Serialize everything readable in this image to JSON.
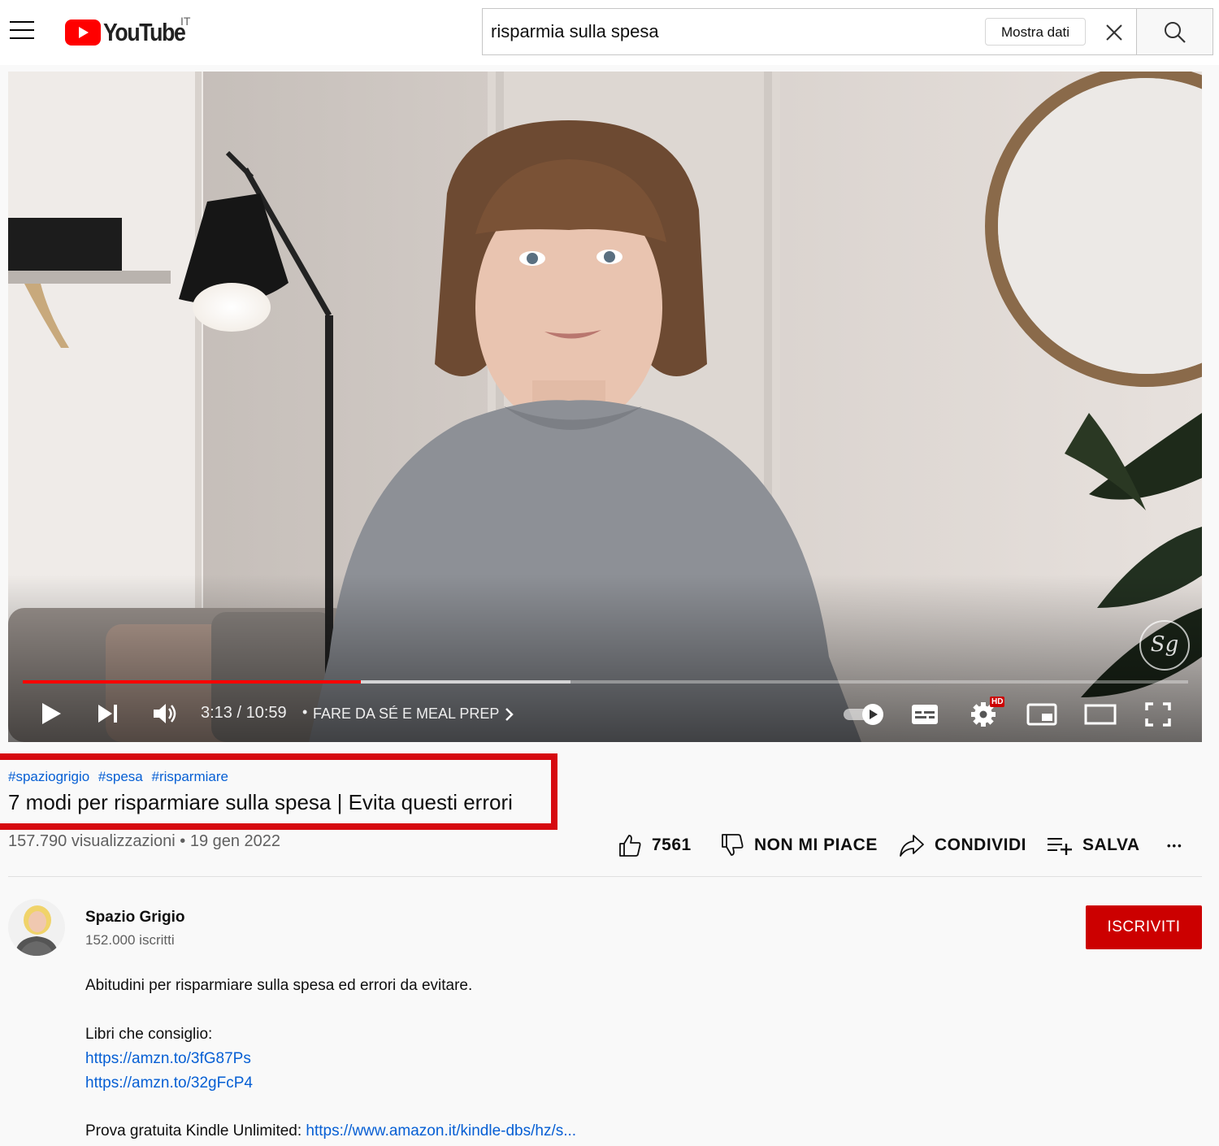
{
  "header": {
    "logo_text": "YouTube",
    "country_code": "IT",
    "search_value": "risparmia sulla spesa",
    "show_data_label": "Mostra dati"
  },
  "player": {
    "current_time": "3:13",
    "time_separator": "/",
    "duration": "10:59",
    "chapter": "FARE DA SÉ E MEAL PREP",
    "watermark": "Sg",
    "hd_badge": "HD",
    "progress_played_fraction": 0.29,
    "progress_buffered_fraction": 0.47
  },
  "video": {
    "hashtags": [
      "#spaziogrigio",
      "#spesa",
      "#risparmiare"
    ],
    "title": "7 modi per risparmiare sulla spesa | Evita questi errori",
    "views": "157.790 visualizzazioni",
    "date": "19 gen 2022",
    "meta_separator": "•"
  },
  "actions": {
    "likes": "7561",
    "dislike_label": "NON MI PIACE",
    "share_label": "CONDIVIDI",
    "save_label": "SALVA",
    "more_label": "•••"
  },
  "channel": {
    "name": "Spazio Grigio",
    "subscribers": "152.000 iscritti",
    "subscribe_label": "ISCRIVITI"
  },
  "description": {
    "line1": "Abitudini per risparmiare sulla spesa ed errori da evitare.",
    "books_label": "Libri che consiglio:",
    "link1": "https://amzn.to/3fG87Ps",
    "link2": "https://amzn.to/32gFcP4",
    "kindle_label": "Prova gratuita Kindle Unlimited: ",
    "kindle_link": "https://www.amazon.it/kindle-dbs/hz/s..."
  },
  "colors": {
    "accent_red": "#cc0000",
    "link_blue": "#065fd4",
    "highlight_border": "#d6080f"
  }
}
